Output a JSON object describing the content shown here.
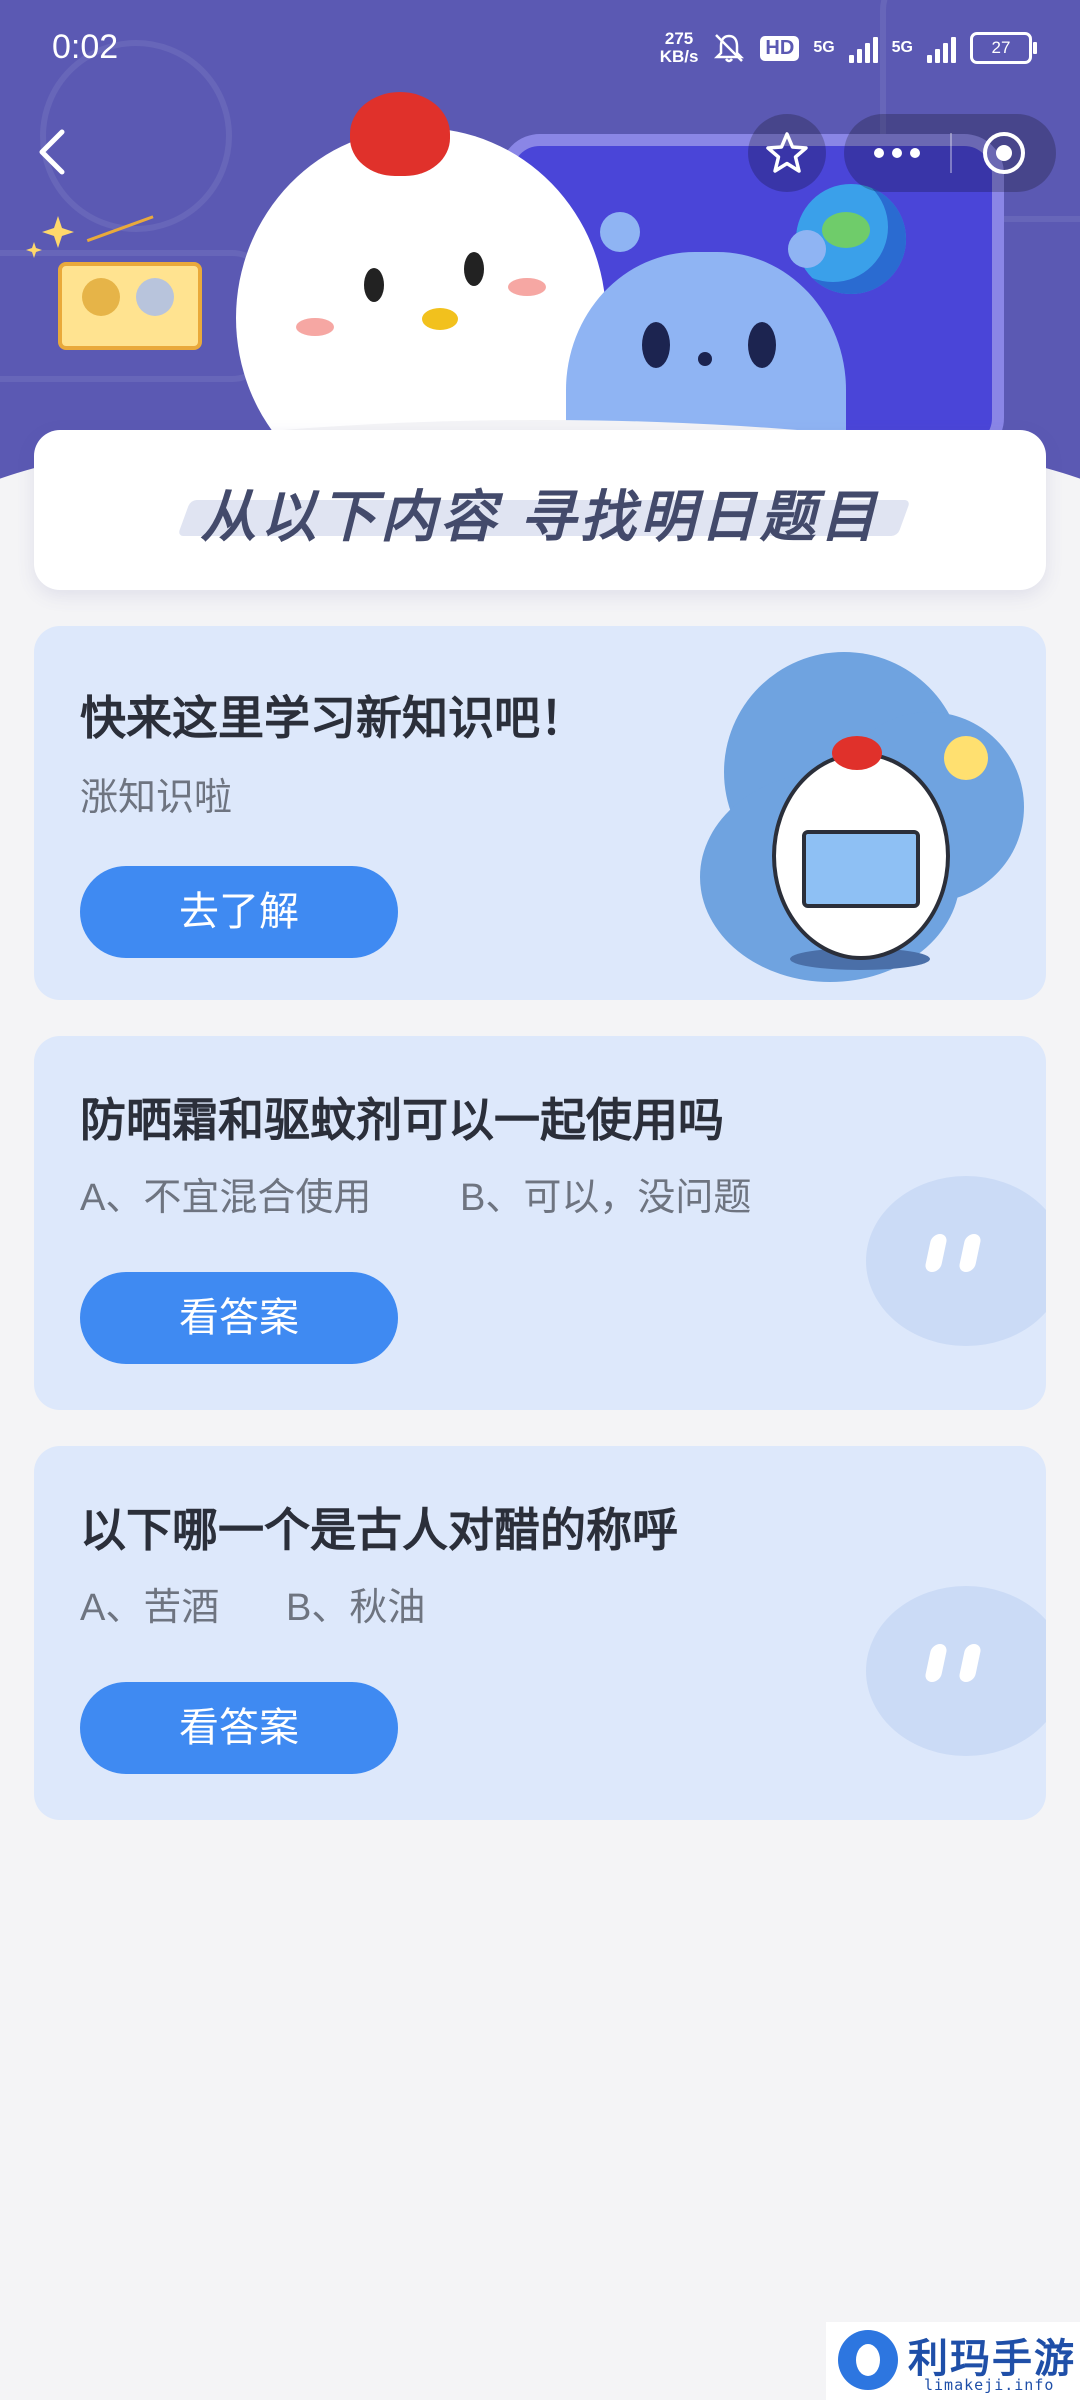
{
  "status_bar": {
    "time": "0:02",
    "net_speed_value": "275",
    "net_speed_unit": "KB/s",
    "hd_label": "HD",
    "network_label_1": "5G",
    "network_label_2": "5G",
    "battery": "27",
    "icons": [
      "mute-icon",
      "signal-icon",
      "battery-icon"
    ]
  },
  "nav": {
    "back_icon": "chevron-left-icon",
    "favorite_icon": "star-icon",
    "more_icon": "more-dots-icon",
    "close_icon": "target-circle-icon"
  },
  "banner": {
    "title": "从以下内容  寻找明日题目"
  },
  "cards": [
    {
      "title": "快来这里学习新知识吧！",
      "subtitle": "涨知识啦",
      "button": "去了解"
    },
    {
      "title": "防晒霜和驱蚊剂可以一起使用吗",
      "option_a": "A、不宜混合使用",
      "option_b": "B、可以，没问题",
      "button": "看答案"
    },
    {
      "title": "以下哪一个是古人对醋的称呼",
      "option_a": "A、苦酒",
      "option_b": "B、秋油",
      "button": "看答案"
    }
  ],
  "watermark": {
    "title": "利玛手游",
    "subtitle": "limakeji.info"
  },
  "colors": {
    "header_bg": "#5b59b3",
    "card_bg": "#dde8fb",
    "button_bg": "#3f8af2",
    "page_bg": "#f4f4f6"
  }
}
